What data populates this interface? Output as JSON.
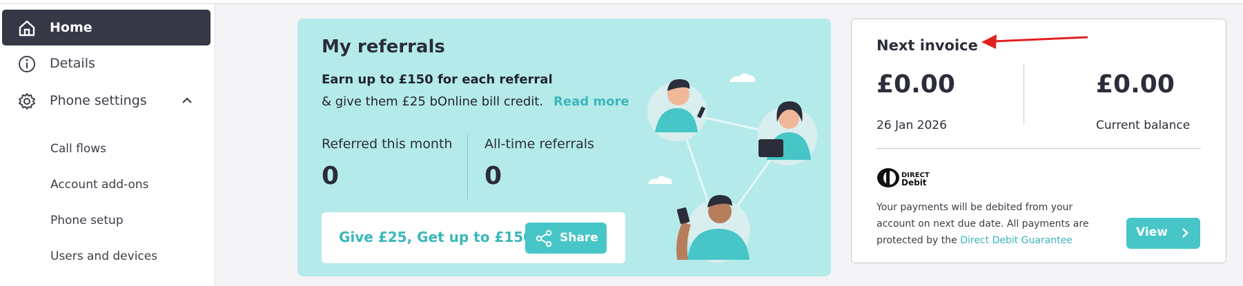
{
  "sidebar": {
    "home_label": "Home",
    "details_label": "Details",
    "phone_settings_label": "Phone settings",
    "sub_items": [
      "Call flows",
      "Account add-ons",
      "Phone setup",
      "Users and devices"
    ]
  },
  "referrals": {
    "title": "My referrals",
    "earn_text": "Earn up to £150 for each referral",
    "give_text": "& give them £25 bOnline bill credit.",
    "read_more": "Read more",
    "month_label": "Referred this month",
    "month_value": "0",
    "alltime_label": "All-time referrals",
    "alltime_value": "0",
    "promo_text": "Give £25, Get up to £150",
    "share_label": "Share"
  },
  "invoice": {
    "title": "Next invoice",
    "next_amount": "£0.00",
    "next_date": "26 Jan 2026",
    "balance_amount": "£0.00",
    "balance_label": "Current balance",
    "dd_logo_line1": "DIRECT",
    "dd_logo_line2": "Debit",
    "dd_text_1": "Your payments will be debited from your account on next due date. All payments are protected by the",
    "dd_link": "Direct Debit Guarantee",
    "view_label": "View"
  },
  "colors": {
    "accent": "#47c5c7",
    "sidebar_active": "#363846",
    "card_bg": "#b5eaea",
    "arrow": "#e02020"
  },
  "icons": [
    "home-icon",
    "info-icon",
    "gear-icon",
    "chevron-up-icon",
    "share-icon",
    "chevron-right-icon",
    "direct-debit-logo"
  ]
}
